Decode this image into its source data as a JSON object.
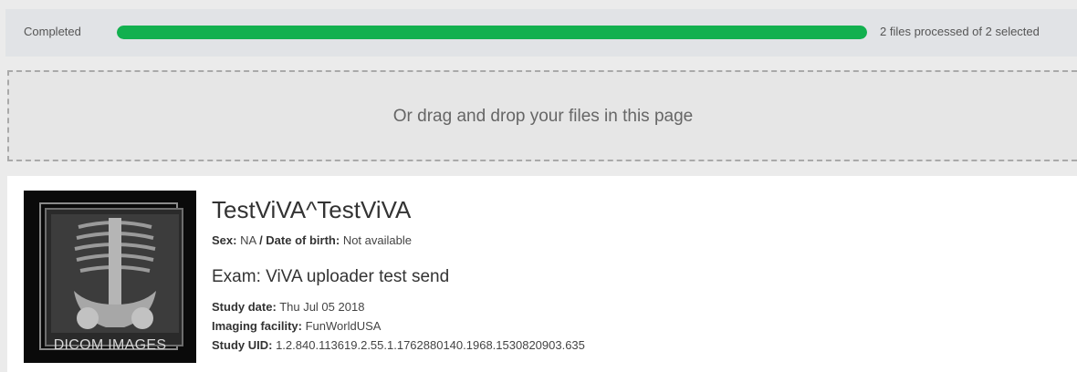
{
  "upload": {
    "status_label": "Completed",
    "progress": 1.0,
    "files_text": "2 files processed of 2 selected"
  },
  "drop_zone": {
    "text": "Or drag and drop your files in this page"
  },
  "study": {
    "thumbnail_label": "DICOM IMAGES",
    "patient_name": "TestViVA^TestViVA",
    "sex_label": "Sex:",
    "sex_value": "NA",
    "dob_label": "Date of birth:",
    "dob_value": "Not available",
    "exam": "Exam: ViVA uploader test send",
    "study_date_label": "Study date:",
    "study_date_value": "Thu Jul 05 2018",
    "facility_label": "Imaging facility:",
    "facility_value": "FunWorldUSA",
    "uid_label": "Study UID:",
    "uid_value": "1.2.840.113619.2.55.1.1762880140.1968.1530820903.635"
  },
  "colors": {
    "progress_fill": "#12b04f",
    "thumbnail_bg": "#0a0a0a"
  }
}
